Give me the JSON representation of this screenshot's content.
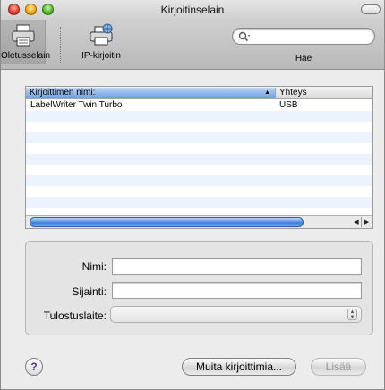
{
  "window": {
    "title": "Kirjoitinselain"
  },
  "toolbar": {
    "default_label": "Oletusselain",
    "ip_label": "IP-kirjoitin",
    "search_label": "Hae",
    "search_placeholder": ""
  },
  "printer_list": {
    "columns": [
      "Kirjoittimen nimi:",
      "Yhteys"
    ],
    "rows": [
      {
        "name": "LabelWriter Twin Turbo",
        "connection": "USB"
      }
    ]
  },
  "attributes": {
    "name_label": "Nimi:",
    "location_label": "Sijainti:",
    "device_label": "Tulostuslaite:",
    "name_value": "",
    "location_value": "",
    "device_value": ""
  },
  "buttons": {
    "help": "?",
    "more_printers": "Muita kirjoittimia...",
    "add": "Lisää"
  },
  "colors": {
    "header_selected": "#6d9de0",
    "scroll_thumb": "#3b80d9",
    "stripe": "#edf3fe"
  }
}
